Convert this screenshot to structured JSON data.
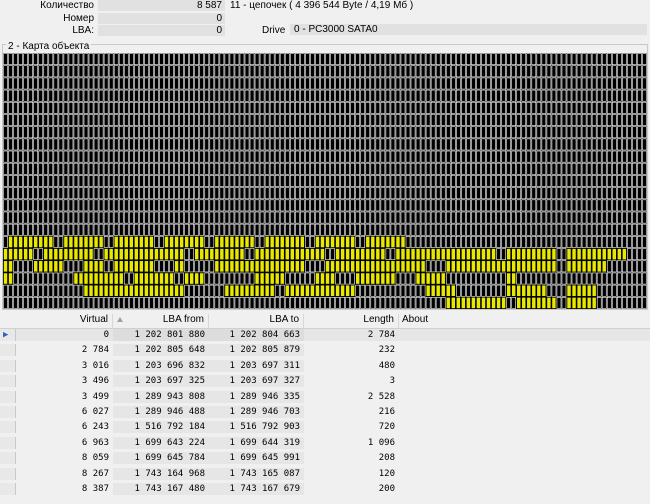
{
  "top": {
    "count_label": "Количество",
    "count_value": "8 587",
    "chains_text": "11 - цепочек  ( 4 396 544 Byte /  4,19 Мб )",
    "number_label": "Номер",
    "number_value": "0",
    "lba_label": "LBA:",
    "lba_value": "0",
    "drive_label": "Drive",
    "drive_value": "0 - PC3000 SATA0"
  },
  "map": {
    "title": "2 - Карта объекта",
    "filled_color": "#e8e800",
    "empty_color": "#000000",
    "cols": 128,
    "rows": 21,
    "filled_runs": [
      [
        15,
        1,
        10
      ],
      [
        15,
        12,
        20
      ],
      [
        15,
        22,
        30
      ],
      [
        15,
        32,
        40
      ],
      [
        15,
        42,
        50
      ],
      [
        15,
        52,
        60
      ],
      [
        15,
        62,
        70
      ],
      [
        15,
        72,
        80
      ],
      [
        16,
        0,
        6
      ],
      [
        16,
        8,
        18
      ],
      [
        16,
        20,
        36
      ],
      [
        16,
        38,
        48
      ],
      [
        16,
        50,
        64
      ],
      [
        16,
        66,
        76
      ],
      [
        16,
        78,
        98
      ],
      [
        16,
        100,
        110
      ],
      [
        16,
        112,
        124
      ],
      [
        17,
        0,
        2
      ],
      [
        17,
        6,
        12
      ],
      [
        17,
        16,
        20
      ],
      [
        17,
        22,
        30
      ],
      [
        17,
        34,
        36
      ],
      [
        17,
        42,
        60
      ],
      [
        17,
        64,
        84
      ],
      [
        17,
        88,
        110
      ],
      [
        17,
        112,
        120
      ],
      [
        18,
        0,
        2
      ],
      [
        18,
        14,
        24
      ],
      [
        18,
        26,
        34
      ],
      [
        18,
        36,
        40
      ],
      [
        18,
        50,
        56
      ],
      [
        18,
        62,
        66
      ],
      [
        18,
        70,
        78
      ],
      [
        18,
        82,
        88
      ],
      [
        18,
        100,
        102
      ],
      [
        19,
        16,
        36
      ],
      [
        19,
        44,
        54
      ],
      [
        19,
        56,
        70
      ],
      [
        19,
        84,
        90
      ],
      [
        19,
        100,
        108
      ],
      [
        19,
        112,
        118
      ],
      [
        20,
        88,
        100
      ],
      [
        20,
        102,
        110
      ],
      [
        20,
        112,
        118
      ]
    ]
  },
  "table": {
    "columns": [
      "Virtual",
      "LBA from",
      "LBA to",
      "Length",
      "About"
    ],
    "rows": [
      {
        "virtual": "0",
        "lba_from": "1 202 801 880",
        "lba_to": "1 202 804 663",
        "length": "2 784",
        "about": ""
      },
      {
        "virtual": "2 784",
        "lba_from": "1 202 805 648",
        "lba_to": "1 202 805 879",
        "length": "232",
        "about": ""
      },
      {
        "virtual": "3 016",
        "lba_from": "1 203 696 832",
        "lba_to": "1 203 697 311",
        "length": "480",
        "about": ""
      },
      {
        "virtual": "3 496",
        "lba_from": "1 203 697 325",
        "lba_to": "1 203 697 327",
        "length": "3",
        "about": ""
      },
      {
        "virtual": "3 499",
        "lba_from": "1 289 943 808",
        "lba_to": "1 289 946 335",
        "length": "2 528",
        "about": ""
      },
      {
        "virtual": "6 027",
        "lba_from": "1 289 946 488",
        "lba_to": "1 289 946 703",
        "length": "216",
        "about": ""
      },
      {
        "virtual": "6 243",
        "lba_from": "1 516 792 184",
        "lba_to": "1 516 792 903",
        "length": "720",
        "about": ""
      },
      {
        "virtual": "6 963",
        "lba_from": "1 699 643 224",
        "lba_to": "1 699 644 319",
        "length": "1 096",
        "about": ""
      },
      {
        "virtual": "8 059",
        "lba_from": "1 699 645 784",
        "lba_to": "1 699 645 991",
        "length": "208",
        "about": ""
      },
      {
        "virtual": "8 267",
        "lba_from": "1 743 164 968",
        "lba_to": "1 743 165 087",
        "length": "120",
        "about": ""
      },
      {
        "virtual": "8 387",
        "lba_from": "1 743 167 480",
        "lba_to": "1 743 167 679",
        "length": "200",
        "about": ""
      }
    ]
  }
}
